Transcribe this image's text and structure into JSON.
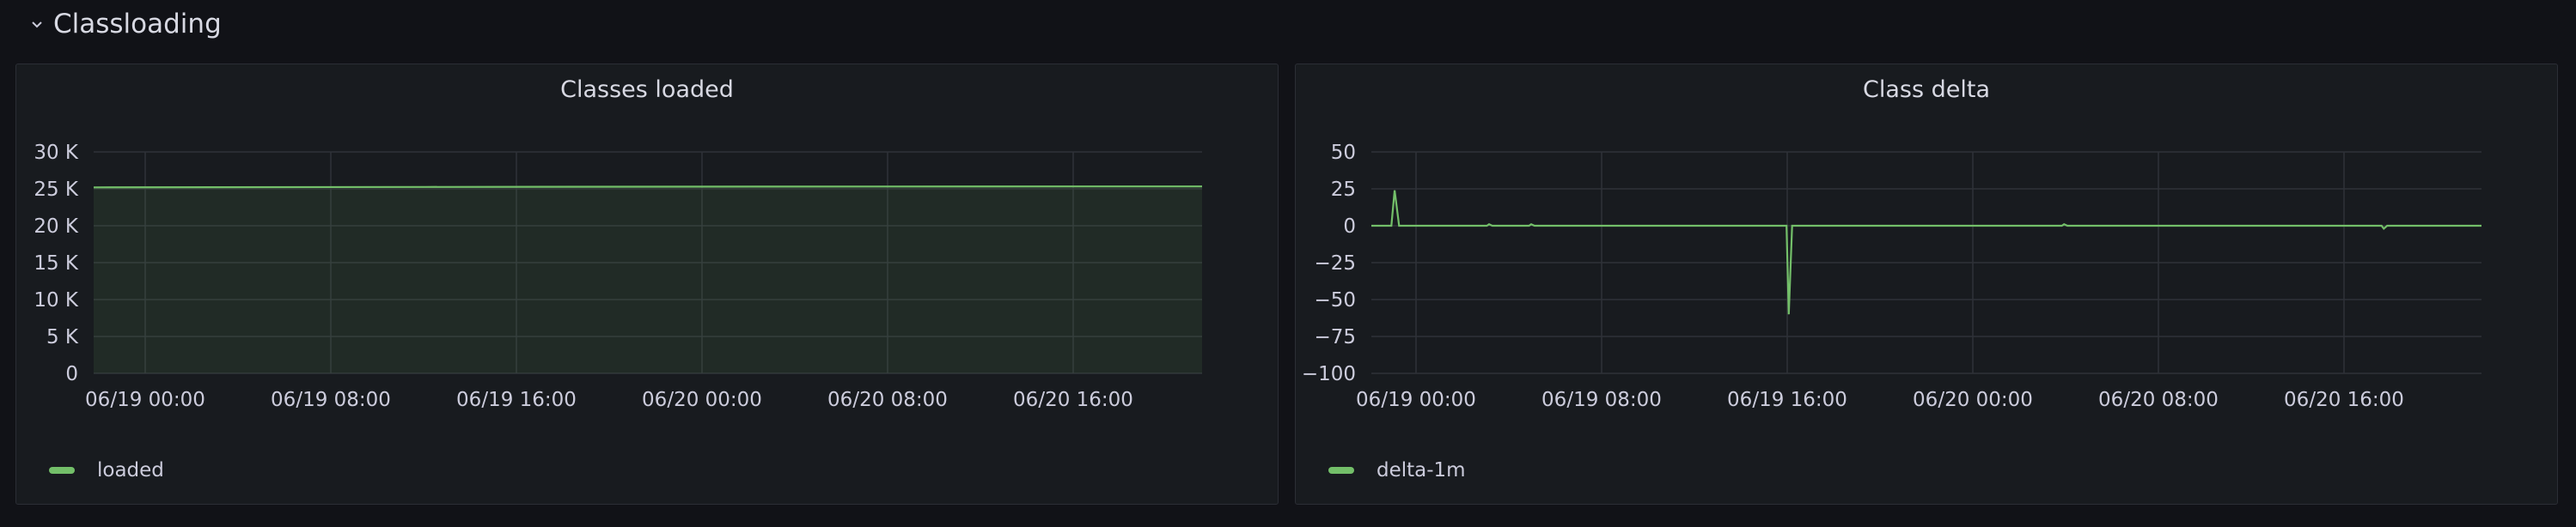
{
  "row": {
    "title": "Classloading",
    "chevron": "chevron-down-icon"
  },
  "panels": [
    {
      "title": "Classes loaded",
      "legend": {
        "label": "loaded",
        "color": "#73bf69"
      },
      "chart_data": {
        "type": "area",
        "title": "Classes loaded",
        "xlabel": "",
        "ylabel": "",
        "x_ticks": [
          "06/19 00:00",
          "06/19 08:00",
          "06/19 16:00",
          "06/20 00:00",
          "06/20 08:00",
          "06/20 16:00"
        ],
        "y_ticks": [
          "30 K",
          "25 K",
          "20 K",
          "15 K",
          "10 K",
          "5 K",
          "0"
        ],
        "ylim": [
          0,
          30000
        ],
        "series": [
          {
            "name": "loaded",
            "color": "#73bf69",
            "points": [
              [
                0,
                25200
              ],
              [
                0.3,
                25250
              ],
              [
                0.6,
                25300
              ],
              [
                0.9,
                25320
              ],
              [
                1.0,
                25330
              ]
            ]
          }
        ],
        "grid": true,
        "legend_position": "bottom-left"
      }
    },
    {
      "title": "Class delta",
      "legend": {
        "label": "delta-1m",
        "color": "#73bf69"
      },
      "chart_data": {
        "type": "line",
        "title": "Class delta",
        "xlabel": "",
        "ylabel": "",
        "x_ticks": [
          "06/19 00:00",
          "06/19 08:00",
          "06/19 16:00",
          "06/20 00:00",
          "06/20 08:00",
          "06/20 16:00"
        ],
        "y_ticks": [
          "50",
          "25",
          "0",
          "−25",
          "−50",
          "−75",
          "−100"
        ],
        "ylim": [
          -100,
          50
        ],
        "series": [
          {
            "name": "delta-1m",
            "color": "#73bf69",
            "points": [
              [
                0,
                0
              ],
              [
                0.018,
                0
              ],
              [
                0.021,
                24
              ],
              [
                0.025,
                0
              ],
              [
                0.104,
                0
              ],
              [
                0.106,
                1
              ],
              [
                0.109,
                0
              ],
              [
                0.142,
                0
              ],
              [
                0.144,
                1
              ],
              [
                0.147,
                0
              ],
              [
                0.374,
                0
              ],
              [
                0.376,
                -60
              ],
              [
                0.379,
                0
              ],
              [
                0.622,
                0
              ],
              [
                0.624,
                1
              ],
              [
                0.627,
                0
              ],
              [
                0.91,
                0
              ],
              [
                0.912,
                -2
              ],
              [
                0.915,
                0
              ],
              [
                1.0,
                0
              ]
            ]
          }
        ],
        "grid": true,
        "legend_position": "bottom-left"
      }
    }
  ]
}
